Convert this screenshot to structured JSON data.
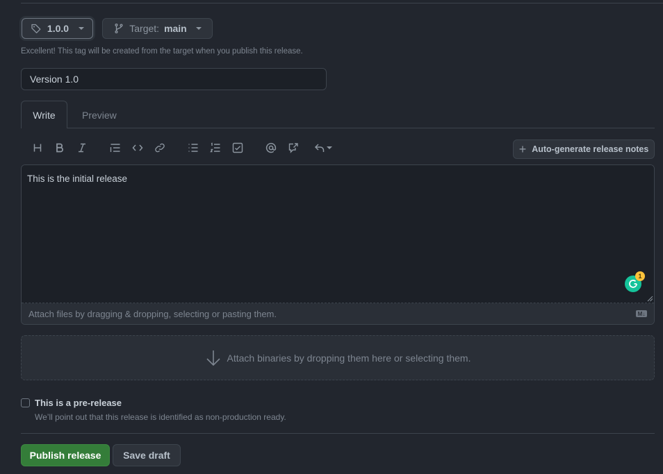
{
  "release_form": {
    "tag": {
      "value": "1.0.0",
      "icon": "tag-icon"
    },
    "target": {
      "label": "Target:",
      "value": "main",
      "icon": "git-branch-icon"
    },
    "tag_hint": "Excellent! This tag will be created from the target when you publish this release.",
    "title_input": {
      "value": "Version 1.0",
      "placeholder": ""
    },
    "tabs": [
      {
        "label": "Write",
        "active": true
      },
      {
        "label": "Preview",
        "active": false
      }
    ],
    "toolbar": {
      "items": [
        {
          "name": "heading",
          "icon": "heading-icon"
        },
        {
          "name": "bold",
          "icon": "bold-icon"
        },
        {
          "name": "italic",
          "icon": "italic-icon"
        },
        {
          "name": "quote",
          "icon": "quote-icon"
        },
        {
          "name": "code",
          "icon": "code-icon"
        },
        {
          "name": "link",
          "icon": "link-icon"
        },
        {
          "name": "unordered-list",
          "icon": "list-unordered-icon"
        },
        {
          "name": "ordered-list",
          "icon": "list-ordered-icon"
        },
        {
          "name": "task-list",
          "icon": "tasklist-icon"
        },
        {
          "name": "mention",
          "icon": "mention-icon"
        },
        {
          "name": "cross-reference",
          "icon": "cross-reference-icon"
        },
        {
          "name": "saved-replies",
          "icon": "reply-icon"
        }
      ],
      "autogen_label": "Auto-generate release notes"
    },
    "body": {
      "value": "This is the initial release",
      "attach_hint": "Attach files by dragging & dropping, selecting or pasting them.",
      "markdown_badge": "M↓"
    },
    "grammarly": {
      "count": "1",
      "color": "#15c39a"
    },
    "binaries_dropzone": "Attach binaries by dropping them here or selecting them.",
    "prerelease": {
      "checked": false,
      "label": "This is a pre-release",
      "description": "We’ll point out that this release is identified as non-production ready."
    },
    "actions": {
      "publish_label": "Publish release",
      "save_draft_label": "Save draft",
      "publish_color": "#347d39"
    }
  }
}
